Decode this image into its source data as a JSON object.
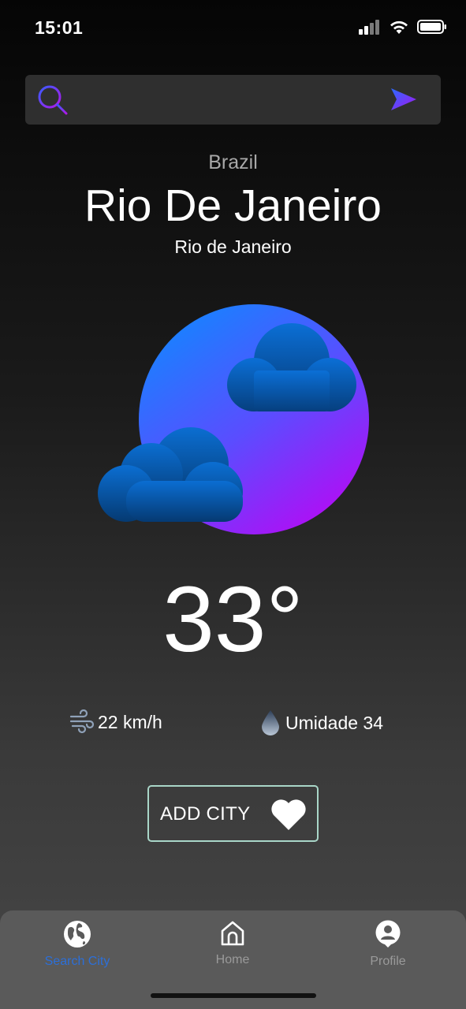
{
  "status_bar": {
    "time": "15:01",
    "icons": [
      "cellular-signal-icon",
      "wifi-icon",
      "battery-icon"
    ]
  },
  "search": {
    "value": "",
    "placeholder": "",
    "icon": "search-icon",
    "submit_icon": "send-icon"
  },
  "location": {
    "country": "Brazil",
    "city": "Rio De Janeiro",
    "region": "Rio de Janeiro"
  },
  "weather": {
    "condition_icon": "partly-cloudy-icon",
    "temperature": "33°",
    "wind": {
      "icon": "wind-icon",
      "value": "22 km/h"
    },
    "humidity": {
      "icon": "water-drop-icon",
      "value": "Umidade 34"
    }
  },
  "actions": {
    "add_city_label": "ADD CITY",
    "add_city_icon": "heart-icon"
  },
  "bottom_nav": {
    "items": [
      {
        "label": "Search City",
        "icon": "globe-icon",
        "active": true
      },
      {
        "label": "Home",
        "icon": "home-icon",
        "active": false
      },
      {
        "label": "Profile",
        "icon": "profile-icon",
        "active": false
      }
    ]
  },
  "colors": {
    "accent_blue": "#2c6fd8",
    "gradient_blue": "#1e7dff",
    "gradient_purple": "#b00ef5",
    "cloud_blue": "#0a5fb8",
    "button_border": "#a9d6c8"
  }
}
